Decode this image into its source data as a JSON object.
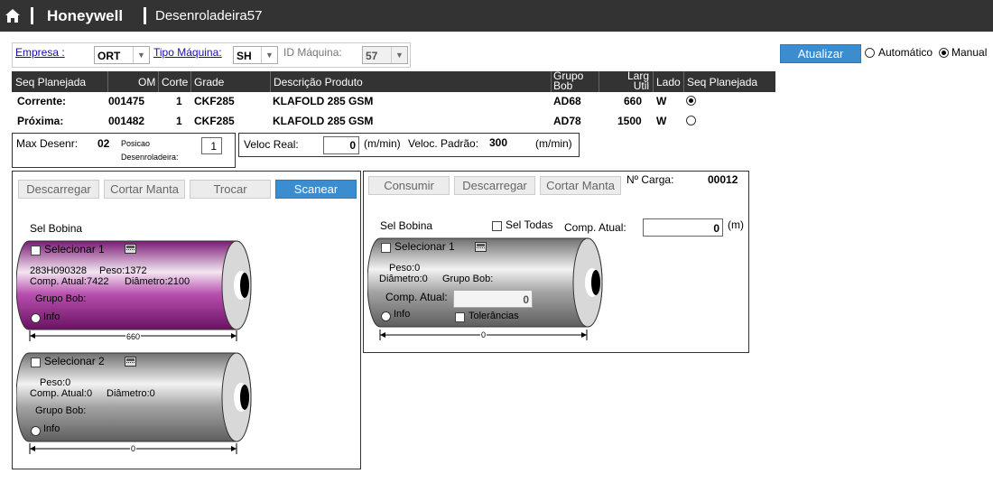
{
  "topbar": {
    "brand": "Honeywell",
    "screen_title": "Desenroladeira57"
  },
  "filters": {
    "empresa_label": "Empresa :",
    "empresa_value": "ORT",
    "tipo_label": "Tipo Máquina:",
    "tipo_value": "SH",
    "id_label": "ID Máquina:",
    "id_value": "57"
  },
  "actions": {
    "atualizar": "Atualizar",
    "automatico": "Automático",
    "manual": "Manual",
    "mode_selected": "Manual"
  },
  "grid": {
    "headers": {
      "seq": "Seq Planejada",
      "om": "OM",
      "corte": "Corte",
      "grade": "Grade",
      "desc": "Descrição Produto",
      "grupo1": "Grupo",
      "grupo2": "Bob",
      "larg1": "Larg",
      "larg2": "Util",
      "lado": "Lado",
      "seq2": "Seq Planejada"
    },
    "rows": [
      {
        "label": "Corrente:",
        "om": "001475",
        "corte": "1",
        "grade": "CKF285",
        "desc": "KLAFOLD 285 GSM",
        "grupo": "AD68",
        "larg": "660",
        "lado": "W",
        "selected": true
      },
      {
        "label": "Próxima:",
        "om": "001482",
        "corte": "1",
        "grade": "CKF285",
        "desc": "KLAFOLD 285 GSM",
        "grupo": "AD78",
        "larg": "1500",
        "lado": "W",
        "selected": false
      }
    ]
  },
  "info": {
    "max_label": "Max Desenr:",
    "max_value": "02",
    "pos_label1": "Posicao",
    "pos_label2": "Desenroladeira:",
    "pos_value": "1",
    "veloc_label": "Veloc Real:",
    "veloc_value": "0",
    "veloc_unit": "(m/min)",
    "padrao_label": "Veloc. Padrão:",
    "padrao_value": "300",
    "padrao_unit": "(m/min)"
  },
  "left_panel": {
    "buttons": {
      "descarregar": "Descarregar",
      "cortar": "Cortar Manta",
      "trocar": "Trocar",
      "scanear": "Scanear"
    },
    "sel_bobina": "Sel Bobina",
    "rolls": [
      {
        "select_label": "Selecionar 1",
        "code": "283H090328",
        "peso": "Peso:1372",
        "comp": "Comp. Atual:7422",
        "diam": "Diâmetro:2100",
        "grupo": "Grupo Bob:",
        "info": "Info",
        "width": "660",
        "color": "#9a2a92"
      },
      {
        "select_label": "Selecionar 2",
        "code": "",
        "peso": "Peso:0",
        "comp": "Comp. Atual:0",
        "diam": "Diâmetro:0",
        "grupo": "Grupo Bob:",
        "info": "Info",
        "width": "0",
        "color": "#8a8a8a"
      }
    ]
  },
  "right_panel": {
    "buttons": {
      "consumir": "Consumir",
      "descarregar": "Descarregar",
      "cortar": "Cortar Manta"
    },
    "carga_label": "Nº Carga:",
    "carga_value": "00012",
    "sel_bobina": "Sel Bobina",
    "sel_todas": "Sel Todas",
    "comp_label": "Comp. Atual:",
    "comp_value": "0",
    "comp_unit": "(m)",
    "roll": {
      "select_label": "Selecionar 1",
      "peso": "Peso:0",
      "diam": "Diâmetro:0",
      "grupo": "Grupo Bob:",
      "comp_label": "Comp. Atual:",
      "comp_value": "0",
      "info": "Info",
      "tolerancias": "Tolerâncias",
      "width": "0"
    }
  }
}
